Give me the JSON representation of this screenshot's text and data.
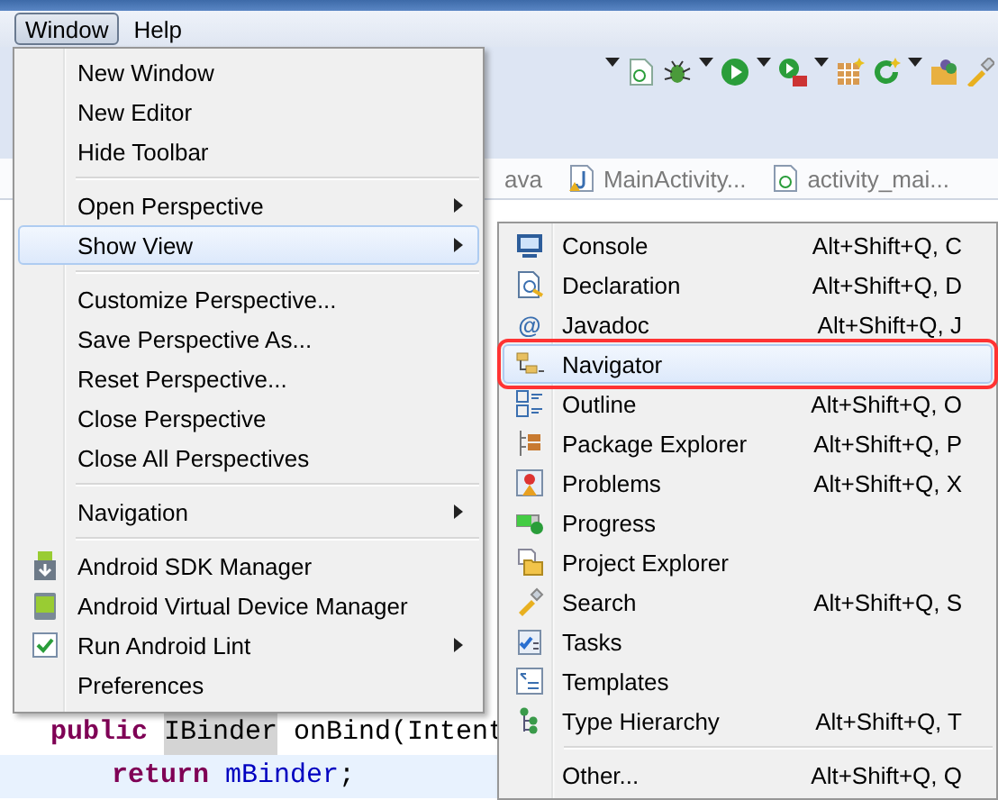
{
  "menubar": [
    {
      "label": "Window",
      "selected": true
    },
    {
      "label": "Help",
      "selected": false
    }
  ],
  "editor_tabs": [
    {
      "label": "ava"
    },
    {
      "label": "MainActivity..."
    },
    {
      "label": "activity_mai..."
    }
  ],
  "code_lines": [
    {
      "current": false,
      "tokens": [
        {
          "kind": "keyword",
          "text": "public"
        },
        {
          "kind": "marked",
          "text": "IBinder"
        },
        {
          "kind": "plain",
          "text": "onBind(Intent"
        }
      ],
      "children": [
        {
          "current": true,
          "tokens": [
            {
              "kind": "keyword",
              "text": "return"
            },
            {
              "kind": "field",
              "text": "mBinder"
            },
            {
              "kind": "punct",
              "text": ";"
            }
          ]
        }
      ]
    }
  ],
  "window_menu": [
    {
      "kind": "item",
      "label": "New Window",
      "submenu": false,
      "selected": false
    },
    {
      "kind": "item",
      "label": "New Editor",
      "submenu": false,
      "selected": false
    },
    {
      "kind": "item",
      "label": "Hide Toolbar",
      "submenu": false,
      "selected": false
    },
    {
      "kind": "separator"
    },
    {
      "kind": "item",
      "label": "Open Perspective",
      "submenu": true,
      "selected": false
    },
    {
      "kind": "item",
      "label": "Show View",
      "submenu": true,
      "selected": true
    },
    {
      "kind": "separator"
    },
    {
      "kind": "item",
      "label": "Customize Perspective...",
      "submenu": false,
      "selected": false
    },
    {
      "kind": "item",
      "label": "Save Perspective As...",
      "submenu": false,
      "selected": false
    },
    {
      "kind": "item",
      "label": "Reset Perspective...",
      "submenu": false,
      "selected": false
    },
    {
      "kind": "item",
      "label": "Close Perspective",
      "submenu": false,
      "selected": false
    },
    {
      "kind": "item",
      "label": "Close All Perspectives",
      "submenu": false,
      "selected": false
    },
    {
      "kind": "separator"
    },
    {
      "kind": "item",
      "label": "Navigation",
      "submenu": true,
      "selected": false
    },
    {
      "kind": "separator"
    },
    {
      "kind": "item",
      "label": "Android SDK Manager",
      "submenu": false,
      "selected": false
    },
    {
      "kind": "item",
      "label": "Android Virtual Device Manager",
      "submenu": false,
      "selected": false
    },
    {
      "kind": "item",
      "label": "Run Android Lint",
      "submenu": true,
      "selected": false
    },
    {
      "kind": "item",
      "label": "Preferences",
      "submenu": false,
      "selected": false
    }
  ],
  "show_view_menu": [
    {
      "kind": "item",
      "label": "Console",
      "shortcut": "Alt+Shift+Q, C",
      "selected": false,
      "outlined": false
    },
    {
      "kind": "item",
      "label": "Declaration",
      "shortcut": "Alt+Shift+Q, D",
      "selected": false,
      "outlined": false
    },
    {
      "kind": "item",
      "glyph": "@",
      "label": "Javadoc",
      "shortcut": "Alt+Shift+Q, J",
      "selected": false,
      "outlined": false
    },
    {
      "kind": "item",
      "label": "Navigator",
      "selected": true,
      "outlined": true
    },
    {
      "kind": "item",
      "label": "Outline",
      "shortcut": "Alt+Shift+Q, O",
      "selected": false,
      "outlined": false
    },
    {
      "kind": "item",
      "label": "Package Explorer",
      "shortcut": "Alt+Shift+Q, P",
      "selected": false,
      "outlined": false
    },
    {
      "kind": "item",
      "label": "Problems",
      "shortcut": "Alt+Shift+Q, X",
      "selected": false,
      "outlined": false
    },
    {
      "kind": "item",
      "label": "Progress",
      "selected": false,
      "outlined": false
    },
    {
      "kind": "item",
      "label": "Project Explorer",
      "selected": false,
      "outlined": false
    },
    {
      "kind": "item",
      "label": "Search",
      "shortcut": "Alt+Shift+Q, S",
      "selected": false,
      "outlined": false
    },
    {
      "kind": "item",
      "label": "Tasks",
      "selected": false,
      "outlined": false
    },
    {
      "kind": "item",
      "label": "Templates",
      "selected": false,
      "outlined": false
    },
    {
      "kind": "item",
      "label": "Type Hierarchy",
      "shortcut": "Alt+Shift+Q, T",
      "selected": false,
      "outlined": false
    },
    {
      "kind": "separator"
    },
    {
      "kind": "item",
      "label": "Other...",
      "shortcut": "Alt+Shift+Q, Q",
      "selected": false,
      "outlined": false
    }
  ]
}
